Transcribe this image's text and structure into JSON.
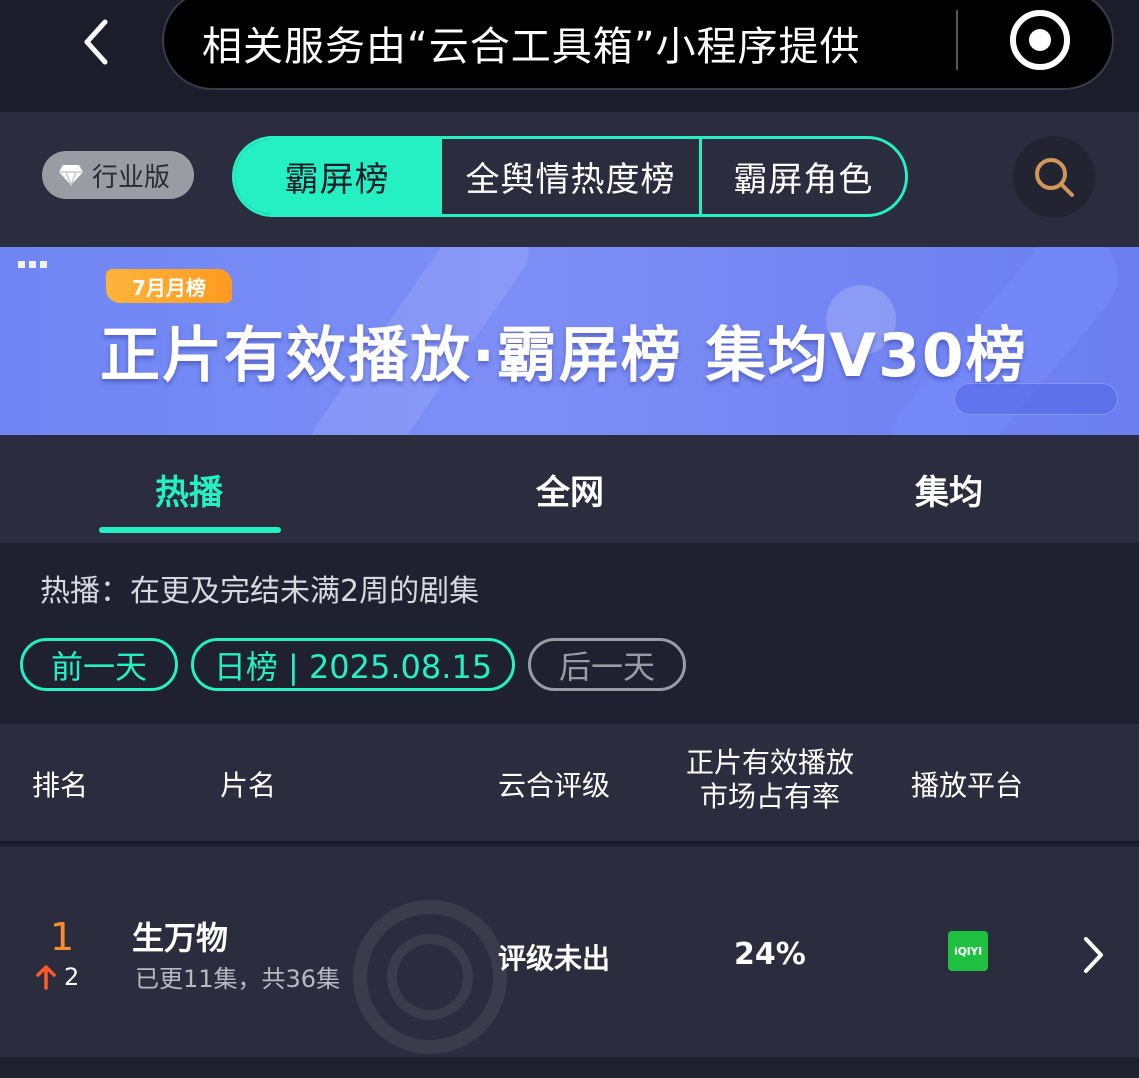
{
  "topbar": {
    "capsule_text": "相关服务由“云合工具箱”小程序提供",
    "back_icon": "chevron-left-icon",
    "target_icon": "record-target-icon"
  },
  "segment": {
    "badge_label": "行业版",
    "items": [
      {
        "label": "霸屏榜",
        "active": true
      },
      {
        "label": "全舆情热度榜",
        "active": false
      },
      {
        "label": "霸屏角色",
        "active": false
      }
    ],
    "search_icon": "search-icon",
    "accent": "#25f0c3"
  },
  "banner": {
    "tag": "7月月榜",
    "title": "正片有效播放·霸屏榜 集均V30榜"
  },
  "tabs": [
    {
      "label": "热播",
      "active": true
    },
    {
      "label": "全网",
      "active": false
    },
    {
      "label": "集均",
      "active": false
    }
  ],
  "description": "热播：在更及完结未满2周的剧集",
  "filters": {
    "prev": "前一天",
    "current": "日榜 | 2025.08.15",
    "next": "后一天"
  },
  "table": {
    "headers": {
      "rank": "排名",
      "name": "片名",
      "rating": "云合评级",
      "share_line1": "正片有效播放",
      "share_line2": "市场占有率",
      "platform": "播放平台"
    },
    "rows": [
      {
        "rank": "1",
        "change": "2",
        "change_dir": "up",
        "title": "生万物",
        "episodes": "已更11集，共36集",
        "rating": "评级未出",
        "share": "24%",
        "platform": "iQIYI",
        "platform_icon": "iqiyi-logo-icon"
      }
    ]
  },
  "colors": {
    "rank_orange": "#ff8c2a",
    "iqiyi_green": "#1ec240",
    "banner_blue": "#7d8ef6"
  }
}
